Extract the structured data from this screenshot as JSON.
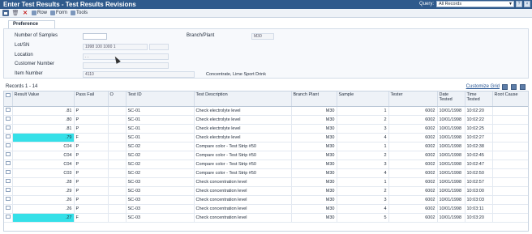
{
  "window": {
    "title": "Enter Test Results - Test Results Revisions",
    "query_label": "Query:",
    "query_value": "All Records",
    "help_btn": "?",
    "close_btn": "×"
  },
  "toolbar": {
    "row_label": "Row",
    "form_label": "Form",
    "tools_label": "Tools"
  },
  "preference": {
    "tab_label": "Preference",
    "number_of_samples_label": "Number of Samples",
    "number_of_samples_value": "",
    "lot_sn_label": "Lot/SN",
    "lot_sn_value": "1998 100 1000 1",
    "location_label": "Location",
    "location_value": ". .",
    "customer_number_label": "Customer Number",
    "customer_number_value": "",
    "item_number_label": "Item Number",
    "item_number_value": "4110",
    "item_description": "Concentrate, Lime Sport Drink",
    "branch_plant_label": "Branch/Plant",
    "branch_plant_value": "M30"
  },
  "grid": {
    "records_label": "Records 1 - 14",
    "customize_label": "Customize Grid",
    "columns": [
      "",
      "Result Value",
      "Pass Fail",
      "O",
      "Test ID",
      "Test Description",
      "Branch Plant",
      "Sample",
      "Tester",
      "Date Tested",
      "Time Tested",
      "Root Cause"
    ],
    "rows": [
      {
        "result": ".81",
        "pass": "P",
        "o": "",
        "test_id": "SC-01",
        "desc": "Check electrolyte level",
        "branch": "M30",
        "sample": "1",
        "tester": "6002",
        "date": "10/01/1998",
        "time": "10:02:20",
        "cause": "",
        "highlight": false
      },
      {
        "result": ".80",
        "pass": "P",
        "o": "",
        "test_id": "SC-01",
        "desc": "Check electrolyte level",
        "branch": "M30",
        "sample": "2",
        "tester": "6002",
        "date": "10/01/1998",
        "time": "10:02:22",
        "cause": "",
        "highlight": false
      },
      {
        "result": ".81",
        "pass": "P",
        "o": "",
        "test_id": "SC-01",
        "desc": "Check electrolyte level",
        "branch": "M30",
        "sample": "3",
        "tester": "6002",
        "date": "10/01/1998",
        "time": "10:02:25",
        "cause": "",
        "highlight": false
      },
      {
        "result": ".79",
        "pass": "F",
        "o": "",
        "test_id": "SC-01",
        "desc": "Check electrolyte level",
        "branch": "M30",
        "sample": "4",
        "tester": "6002",
        "date": "10/01/1998",
        "time": "10:02:27",
        "cause": "",
        "highlight": true
      },
      {
        "result": "C04",
        "pass": "P",
        "o": "",
        "test_id": "SC-02",
        "desc": "Compare color - Test Strip #50",
        "branch": "M30",
        "sample": "1",
        "tester": "6002",
        "date": "10/01/1998",
        "time": "10:02:38",
        "cause": "",
        "highlight": false
      },
      {
        "result": "C04",
        "pass": "P",
        "o": "",
        "test_id": "SC-02",
        "desc": "Compare color - Test Strip #50",
        "branch": "M30",
        "sample": "2",
        "tester": "6002",
        "date": "10/01/1998",
        "time": "10:02:45",
        "cause": "",
        "highlight": false
      },
      {
        "result": "C04",
        "pass": "P",
        "o": "",
        "test_id": "SC-02",
        "desc": "Compare color - Test Strip #50",
        "branch": "M30",
        "sample": "3",
        "tester": "6002",
        "date": "10/01/1998",
        "time": "10:02:47",
        "cause": "",
        "highlight": false
      },
      {
        "result": "C03",
        "pass": "P",
        "o": "",
        "test_id": "SC-02",
        "desc": "Compare color - Test Strip #50",
        "branch": "M30",
        "sample": "4",
        "tester": "6002",
        "date": "10/01/1998",
        "time": "10:02:50",
        "cause": "",
        "highlight": false
      },
      {
        "result": ".28",
        "pass": "P",
        "o": "",
        "test_id": "SC-03",
        "desc": "Check concentration level",
        "branch": "M30",
        "sample": "1",
        "tester": "6002",
        "date": "10/01/1998",
        "time": "10:02:57",
        "cause": "",
        "highlight": false
      },
      {
        "result": ".29",
        "pass": "P",
        "o": "",
        "test_id": "SC-03",
        "desc": "Check concentration level",
        "branch": "M30",
        "sample": "2",
        "tester": "6002",
        "date": "10/01/1998",
        "time": "10:03:00",
        "cause": "",
        "highlight": false
      },
      {
        "result": ".26",
        "pass": "P",
        "o": "",
        "test_id": "SC-03",
        "desc": "Check concentration level",
        "branch": "M30",
        "sample": "3",
        "tester": "6002",
        "date": "10/01/1998",
        "time": "10:03:03",
        "cause": "",
        "highlight": false
      },
      {
        "result": ".26",
        "pass": "P",
        "o": "",
        "test_id": "SC-03",
        "desc": "Check concentration level",
        "branch": "M30",
        "sample": "4",
        "tester": "6002",
        "date": "10/01/1998",
        "time": "10:03:11",
        "cause": "",
        "highlight": false
      },
      {
        "result": ".27",
        "pass": "F",
        "o": "",
        "test_id": "SC-03",
        "desc": "Check concentration level",
        "branch": "M30",
        "sample": "5",
        "tester": "6002",
        "date": "10/01/1998",
        "time": "10:03:20",
        "cause": "",
        "highlight": true
      }
    ]
  },
  "colors": {
    "title_bar": "#2f5a8c",
    "highlight": "#35e0e8",
    "delete_icon": "#c41e1e",
    "link": "#1f4f8f"
  },
  "icons": [
    "save-icon",
    "trash-icon",
    "delete-x-icon",
    "row-icon",
    "form-icon",
    "tools-icon",
    "grid-export-icon",
    "grid-layout-icon",
    "grid-help-icon"
  ]
}
